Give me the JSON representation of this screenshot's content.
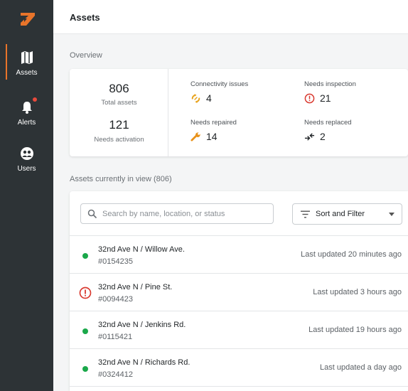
{
  "sidebar": {
    "items": [
      {
        "label": "Assets",
        "icon": "map-icon"
      },
      {
        "label": "Alerts",
        "icon": "bell-icon"
      },
      {
        "label": "Users",
        "icon": "users-icon"
      }
    ],
    "accent_color": "#e8742a"
  },
  "header": {
    "title": "Assets"
  },
  "overview": {
    "label": "Overview",
    "total_assets": {
      "value": "806",
      "label": "Total assets"
    },
    "needs_activation": {
      "value": "121",
      "label": "Needs activation"
    },
    "stats": [
      {
        "label": "Connectivity issues",
        "value": "4",
        "icon": "connectivity-icon"
      },
      {
        "label": "Needs inspection",
        "value": "21",
        "icon": "warning-icon"
      },
      {
        "label": "Needs repaired",
        "value": "14",
        "icon": "wrench-icon"
      },
      {
        "label": "Needs replaced",
        "value": "2",
        "icon": "replace-icon"
      }
    ]
  },
  "assets_list": {
    "label": "Assets currently in view (806)",
    "search_placeholder": "Search by name, location, or status",
    "sort_label": "Sort and Filter",
    "rows": [
      {
        "name": "32nd Ave N / Willow Ave.",
        "id": "#0154235",
        "updated": "Last updated 20 minutes ago",
        "status": "ok"
      },
      {
        "name": "32nd Ave N / Pine St.",
        "id": "#0094423",
        "updated": "Last updated 3 hours ago",
        "status": "warning"
      },
      {
        "name": "32nd Ave N / Jenkins Rd.",
        "id": "#0115421",
        "updated": "Last updated 19 hours ago",
        "status": "ok"
      },
      {
        "name": "32nd Ave N / Richards Rd.",
        "id": "#0324412",
        "updated": "Last updated a day ago",
        "status": "ok"
      }
    ]
  },
  "colors": {
    "ok": "#1aa84a",
    "warning": "#d93a30",
    "sidebar": "#2d3336"
  }
}
